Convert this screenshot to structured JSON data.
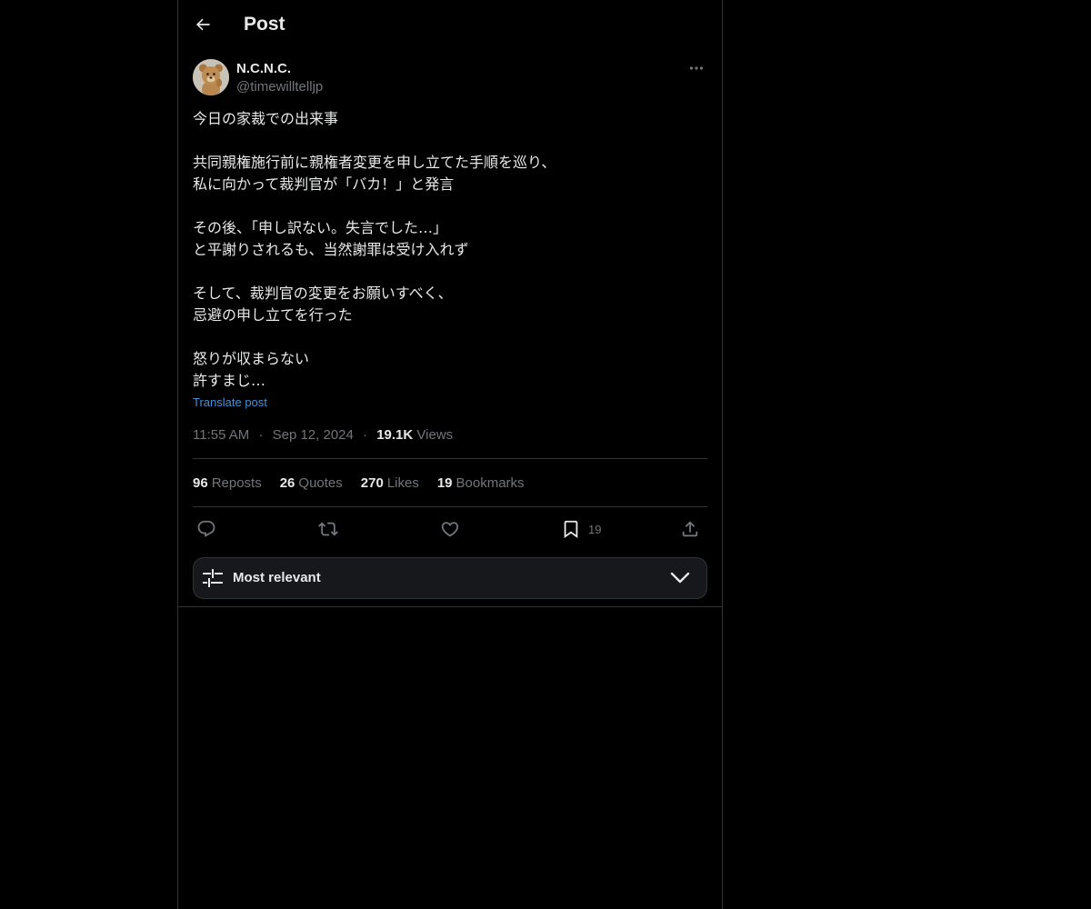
{
  "header": {
    "title": "Post"
  },
  "author": {
    "display_name": "N.C.N.C.",
    "handle": "@timewilltelljp",
    "avatar_icon": "teddy-bear-avatar"
  },
  "post": {
    "lines": [
      "今日の家裁での出来事",
      "",
      "共同親権施行前に親権者変更を申し立てた手順を巡り、",
      "私に向かって裁判官が「バカ！」と発言",
      "",
      "その後、「申し訳ない。失言でした…」",
      "と平謝りされるも、当然謝罪は受け入れず",
      "",
      "そして、裁判官の変更をお願いすべく、",
      "忌避の申し立てを行った",
      "",
      "怒りが収まらない",
      "許すまじ…"
    ],
    "translate_label": "Translate post"
  },
  "meta": {
    "time": "11:55 AM",
    "separator": "·",
    "date": "Sep 12, 2024",
    "views_count": "19.1K",
    "views_label": "Views"
  },
  "stats": [
    {
      "count": "96",
      "label": "Reposts"
    },
    {
      "count": "26",
      "label": "Quotes"
    },
    {
      "count": "270",
      "label": "Likes"
    },
    {
      "count": "19",
      "label": "Bookmarks"
    }
  ],
  "actions": {
    "reply_icon": "reply-icon",
    "repost_icon": "repost-icon",
    "like_icon": "heart-icon",
    "bookmark_icon": "bookmark-icon",
    "bookmark_count": "19",
    "share_icon": "share-icon"
  },
  "sort": {
    "label": "Most relevant"
  },
  "colors": {
    "background": "#000000",
    "text": "#e7e9ea",
    "muted": "#71767b",
    "border": "#2f3336",
    "link": "#4a8fd6"
  }
}
